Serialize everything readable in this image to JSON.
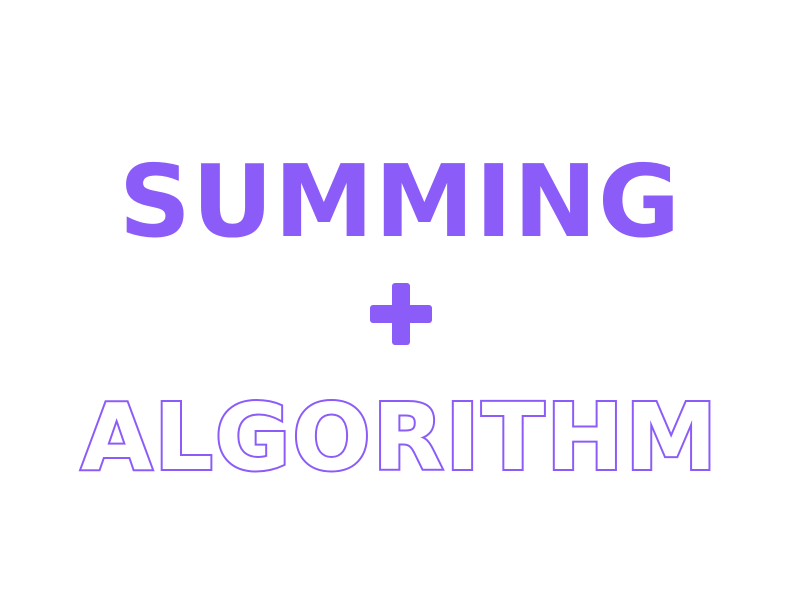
{
  "title": {
    "line1": "SUMMING",
    "line2": "ALGORITHM"
  },
  "icons": {
    "connector": "plus-icon"
  },
  "colors": {
    "accent": "#8c5cf8",
    "background": "#ffffff"
  }
}
